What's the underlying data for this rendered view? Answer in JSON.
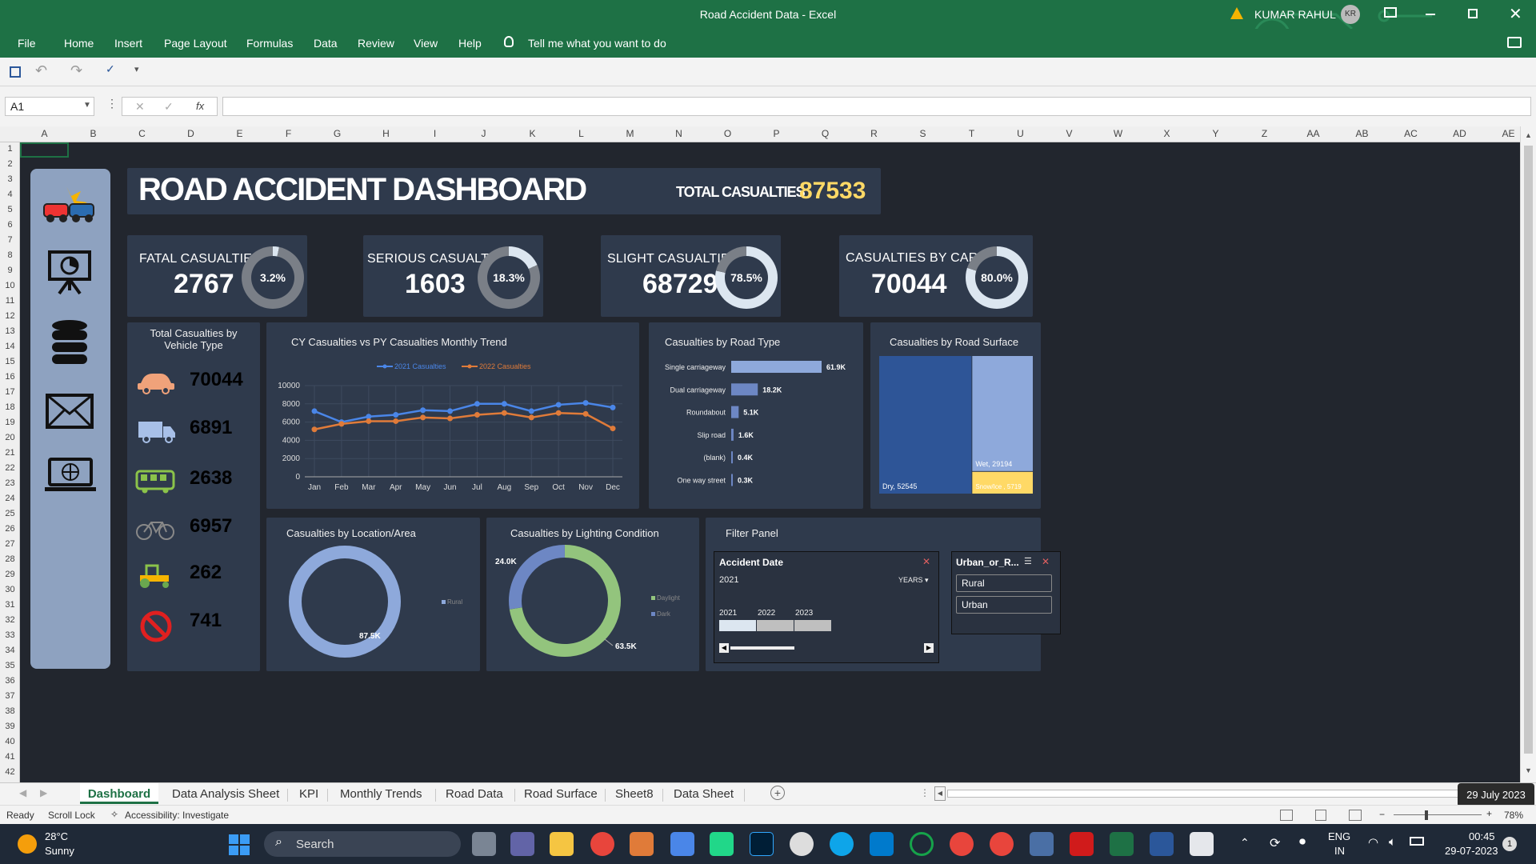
{
  "window": {
    "title": "Road Accident Data  -  Excel",
    "user": "KUMAR RAHUL",
    "initials": "KR"
  },
  "ribbon": {
    "tabs": [
      "File",
      "Home",
      "Insert",
      "Page Layout",
      "Formulas",
      "Data",
      "Review",
      "View",
      "Help"
    ],
    "tell_me": "Tell me what you want to do"
  },
  "formula_bar": {
    "name_box": "A1",
    "cancel": "✕",
    "enter": "✓",
    "fx": "fx",
    "value": ""
  },
  "grid": {
    "columns": [
      "A",
      "B",
      "C",
      "D",
      "E",
      "F",
      "G",
      "H",
      "I",
      "J",
      "K",
      "L",
      "M",
      "N",
      "O",
      "P",
      "Q",
      "R",
      "S",
      "T",
      "U",
      "V",
      "W",
      "X",
      "Y",
      "Z",
      "AA",
      "AB",
      "AC",
      "AD",
      "AE"
    ],
    "rows": [
      "1",
      "2",
      "3",
      "4",
      "5",
      "6",
      "7",
      "8",
      "9",
      "10",
      "11",
      "12",
      "13",
      "14",
      "15",
      "16",
      "17",
      "18",
      "19",
      "20",
      "21",
      "22",
      "23",
      "24",
      "25",
      "26",
      "27",
      "28",
      "29",
      "30",
      "31",
      "32",
      "33",
      "34",
      "35",
      "36",
      "37",
      "38",
      "39",
      "40",
      "41",
      "42"
    ]
  },
  "dashboard": {
    "title": "ROAD ACCIDENT DASHBOARD",
    "total_label": "TOTAL CASUALTIES",
    "total_value": "87533",
    "kpis": [
      {
        "label": "FATAL CASUALTIES",
        "value": "2767",
        "pct": "3.2%",
        "fraction": 0.032
      },
      {
        "label": "SERIOUS CASUALTIES",
        "value": "1603",
        "pct": "18.3%",
        "fraction": 0.183
      },
      {
        "label": "SLIGHT CASUALTIES",
        "value": "68729",
        "pct": "78.5%",
        "fraction": 0.785
      },
      {
        "label": "CASUALTIES BY CAR",
        "value": "70044",
        "pct": "80.0%",
        "fraction": 0.8
      }
    ],
    "vehicle_panel": {
      "title": "Total Casualties by Vehicle Type",
      "items": [
        {
          "icon": "car-icon",
          "value": "70044",
          "color": "#f0a27a"
        },
        {
          "icon": "truck-icon",
          "value": "6891",
          "color": "#a8c0e8"
        },
        {
          "icon": "bus-icon",
          "value": "2638",
          "color": "#8bc34a"
        },
        {
          "icon": "bicycle-icon",
          "value": "6957",
          "color": "#e0712a"
        },
        {
          "icon": "tractor-icon",
          "value": "262",
          "color": "#6aa84f"
        },
        {
          "icon": "no-entry-icon",
          "value": "741",
          "color": "#e02020"
        }
      ]
    },
    "sidebar_icons": [
      "car-crash-icon",
      "presentation-icon",
      "database-icon",
      "mail-icon",
      "laptop-globe-icon"
    ],
    "filter_panel": {
      "title": "Filter Panel",
      "date_slicer": {
        "title": "Accident Date",
        "selected": "2021",
        "level": "YEARS",
        "years": [
          "2021",
          "2022",
          "2023"
        ]
      },
      "area_slicer": {
        "title": "Urban_or_R...",
        "items": [
          "Rural",
          "Urban"
        ]
      }
    }
  },
  "chart_data": [
    {
      "type": "line",
      "title": "CY Casualties vs PY Casualties Monthly Trend",
      "x": [
        "Jan",
        "Feb",
        "Mar",
        "Apr",
        "May",
        "Jun",
        "Jul",
        "Aug",
        "Sep",
        "Oct",
        "Nov",
        "Dec"
      ],
      "series": [
        {
          "name": "2021 Casualties",
          "color": "#4a86e8",
          "values": [
            7200,
            6000,
            6600,
            6800,
            7300,
            7200,
            8000,
            8000,
            7200,
            7900,
            8100,
            7600
          ]
        },
        {
          "name": "2022 Casualties",
          "color": "#e07b39",
          "values": [
            5200,
            5800,
            6100,
            6100,
            6500,
            6400,
            6800,
            7000,
            6500,
            7000,
            6900,
            5300
          ]
        }
      ],
      "ylim": [
        0,
        10000
      ],
      "yticks": [
        "0",
        "2000",
        "4000",
        "6000",
        "8000",
        "10000"
      ]
    },
    {
      "type": "bar",
      "title": "Casualties by Road Type",
      "categories": [
        "Single carriageway",
        "Dual carriageway",
        "Roundabout",
        "Slip road",
        "(blank)",
        "One way street"
      ],
      "values": [
        61.9,
        18.2,
        5.1,
        1.6,
        0.4,
        0.3
      ],
      "labels": [
        "61.9K",
        "18.2K",
        "5.1K",
        "1.6K",
        "0.4K",
        "0.3K"
      ]
    },
    {
      "type": "treemap",
      "title": "Casualties by Road Surface",
      "items": [
        {
          "name": "Dry",
          "value": 52545,
          "label": "Dry, 52545"
        },
        {
          "name": "Wet",
          "value": 29194,
          "label": "Wet, 29194"
        },
        {
          "name": "Snow/Ice",
          "value": 5719,
          "label": "Snow/Ice , 5719"
        }
      ]
    },
    {
      "type": "pie",
      "title": "Casualties by Location/Area",
      "slices": [
        {
          "name": "Rural",
          "value": 87.5,
          "label": "87.5K"
        }
      ],
      "legend": [
        "Rural"
      ]
    },
    {
      "type": "pie",
      "title": "Casualties by Lighting Condition",
      "slices": [
        {
          "name": "Daylight",
          "value": 63.5,
          "label": "63.5K"
        },
        {
          "name": "Dark",
          "value": 24.0,
          "label": "24.0K"
        }
      ],
      "legend": [
        "Daylight",
        "Dark"
      ]
    }
  ],
  "sheet_tabs": [
    "Dashboard",
    "Data Analysis Sheet",
    "KPI",
    "Monthly Trends",
    "Road Data",
    "Road Surface",
    "Sheet8",
    "Data Sheet"
  ],
  "status": {
    "ready": "Ready",
    "scroll_lock": "Scroll Lock",
    "accessibility": "Accessibility: Investigate",
    "zoom": "78%",
    "tooltip": "29 July 2023"
  },
  "taskbar": {
    "temp": "28°C",
    "weather": "Sunny",
    "search": "Search",
    "lang1": "ENG",
    "lang2": "IN",
    "time": "00:45",
    "date": "29-07-2023",
    "notifications": "1"
  }
}
